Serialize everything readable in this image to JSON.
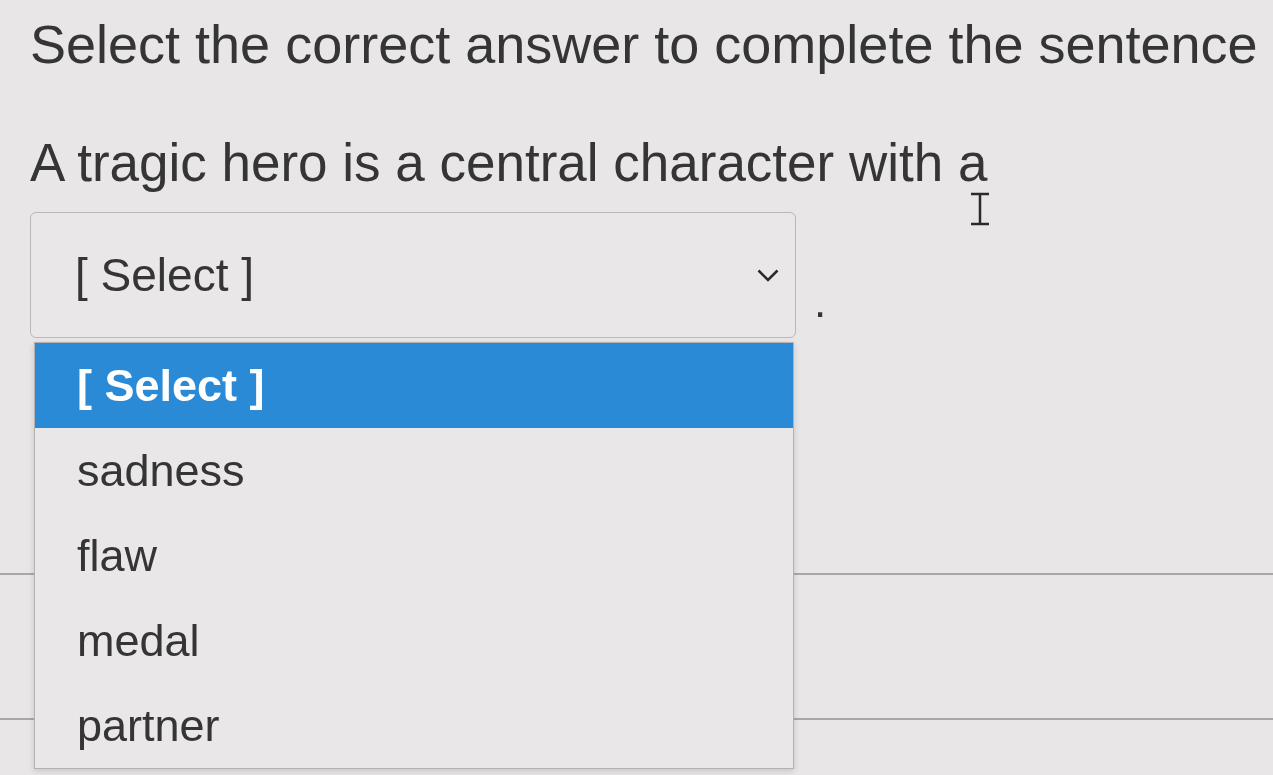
{
  "question": {
    "instruction": "Select the correct answer to complete the sentence",
    "sentence": "A tragic hero is a central character with a",
    "after_blank": "."
  },
  "dropdown": {
    "value": "[ Select ]",
    "expanded": true,
    "options": [
      {
        "label": "[ Select ]",
        "selected": true
      },
      {
        "label": "sadness",
        "selected": false
      },
      {
        "label": "flaw",
        "selected": false
      },
      {
        "label": "medal",
        "selected": false
      },
      {
        "label": "partner",
        "selected": false
      }
    ]
  }
}
